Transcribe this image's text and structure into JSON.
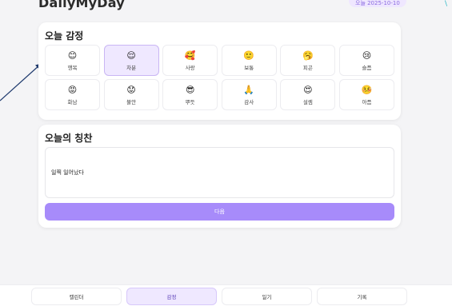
{
  "header": {
    "app_title": "DailyMyDay",
    "date_badge": "오늘 2025-10-10",
    "corner_mark": "\\"
  },
  "emotions_card": {
    "title": "오늘 감정",
    "items": [
      {
        "icon": "😊",
        "icon_name": "smiling-face-icon",
        "label": "행복",
        "selected": false
      },
      {
        "icon": "😌",
        "icon_name": "relieved-face-icon",
        "label": "차분",
        "selected": true
      },
      {
        "icon": "🥰",
        "icon_name": "smiling-hearts-face-icon",
        "label": "사랑",
        "selected": false
      },
      {
        "icon": "🙂",
        "icon_name": "slightly-smiling-face-icon",
        "label": "보통",
        "selected": false
      },
      {
        "icon": "🥱",
        "icon_name": "yawning-face-icon",
        "label": "피곤",
        "selected": false
      },
      {
        "icon": "😢",
        "icon_name": "crying-face-icon",
        "label": "슬픔",
        "selected": false
      },
      {
        "icon": "😡",
        "icon_name": "angry-face-icon",
        "label": "화남",
        "selected": false
      },
      {
        "icon": "😟",
        "icon_name": "worried-face-icon",
        "label": "불안",
        "selected": false
      },
      {
        "icon": "😎",
        "icon_name": "sunglasses-face-icon",
        "label": "뿌듯",
        "selected": false
      },
      {
        "icon": "🙏",
        "icon_name": "folded-hands-icon",
        "label": "감사",
        "selected": false
      },
      {
        "icon": "😍",
        "icon_name": "heart-eyes-face-icon",
        "label": "설렘",
        "selected": false
      },
      {
        "icon": "🤒",
        "icon_name": "sick-face-icon",
        "label": "아픔",
        "selected": false
      }
    ]
  },
  "praise_card": {
    "title": "오늘의 칭찬",
    "input_value": "일찍 일어났다",
    "next_label": "다음"
  },
  "bottom_nav": {
    "tabs": [
      {
        "label": "캘린더",
        "active": false
      },
      {
        "label": "감정",
        "active": true
      },
      {
        "label": "일기",
        "active": false
      },
      {
        "label": "기록",
        "active": false
      }
    ]
  },
  "colors": {
    "accent": "#a78bfa",
    "selected_bg": "#efe8ff",
    "arrow": "#1f3a6e"
  }
}
